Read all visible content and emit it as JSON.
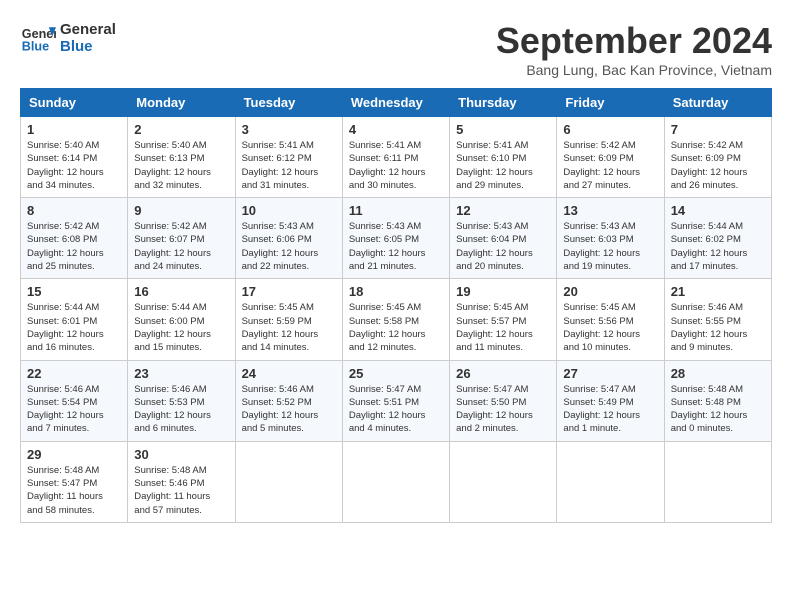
{
  "header": {
    "logo_line1": "General",
    "logo_line2": "Blue",
    "month": "September 2024",
    "location": "Bang Lung, Bac Kan Province, Vietnam"
  },
  "weekdays": [
    "Sunday",
    "Monday",
    "Tuesday",
    "Wednesday",
    "Thursday",
    "Friday",
    "Saturday"
  ],
  "weeks": [
    [
      {
        "day": 1,
        "info": "Sunrise: 5:40 AM\nSunset: 6:14 PM\nDaylight: 12 hours\nand 34 minutes."
      },
      {
        "day": 2,
        "info": "Sunrise: 5:40 AM\nSunset: 6:13 PM\nDaylight: 12 hours\nand 32 minutes."
      },
      {
        "day": 3,
        "info": "Sunrise: 5:41 AM\nSunset: 6:12 PM\nDaylight: 12 hours\nand 31 minutes."
      },
      {
        "day": 4,
        "info": "Sunrise: 5:41 AM\nSunset: 6:11 PM\nDaylight: 12 hours\nand 30 minutes."
      },
      {
        "day": 5,
        "info": "Sunrise: 5:41 AM\nSunset: 6:10 PM\nDaylight: 12 hours\nand 29 minutes."
      },
      {
        "day": 6,
        "info": "Sunrise: 5:42 AM\nSunset: 6:09 PM\nDaylight: 12 hours\nand 27 minutes."
      },
      {
        "day": 7,
        "info": "Sunrise: 5:42 AM\nSunset: 6:09 PM\nDaylight: 12 hours\nand 26 minutes."
      }
    ],
    [
      {
        "day": 8,
        "info": "Sunrise: 5:42 AM\nSunset: 6:08 PM\nDaylight: 12 hours\nand 25 minutes."
      },
      {
        "day": 9,
        "info": "Sunrise: 5:42 AM\nSunset: 6:07 PM\nDaylight: 12 hours\nand 24 minutes."
      },
      {
        "day": 10,
        "info": "Sunrise: 5:43 AM\nSunset: 6:06 PM\nDaylight: 12 hours\nand 22 minutes."
      },
      {
        "day": 11,
        "info": "Sunrise: 5:43 AM\nSunset: 6:05 PM\nDaylight: 12 hours\nand 21 minutes."
      },
      {
        "day": 12,
        "info": "Sunrise: 5:43 AM\nSunset: 6:04 PM\nDaylight: 12 hours\nand 20 minutes."
      },
      {
        "day": 13,
        "info": "Sunrise: 5:43 AM\nSunset: 6:03 PM\nDaylight: 12 hours\nand 19 minutes."
      },
      {
        "day": 14,
        "info": "Sunrise: 5:44 AM\nSunset: 6:02 PM\nDaylight: 12 hours\nand 17 minutes."
      }
    ],
    [
      {
        "day": 15,
        "info": "Sunrise: 5:44 AM\nSunset: 6:01 PM\nDaylight: 12 hours\nand 16 minutes."
      },
      {
        "day": 16,
        "info": "Sunrise: 5:44 AM\nSunset: 6:00 PM\nDaylight: 12 hours\nand 15 minutes."
      },
      {
        "day": 17,
        "info": "Sunrise: 5:45 AM\nSunset: 5:59 PM\nDaylight: 12 hours\nand 14 minutes."
      },
      {
        "day": 18,
        "info": "Sunrise: 5:45 AM\nSunset: 5:58 PM\nDaylight: 12 hours\nand 12 minutes."
      },
      {
        "day": 19,
        "info": "Sunrise: 5:45 AM\nSunset: 5:57 PM\nDaylight: 12 hours\nand 11 minutes."
      },
      {
        "day": 20,
        "info": "Sunrise: 5:45 AM\nSunset: 5:56 PM\nDaylight: 12 hours\nand 10 minutes."
      },
      {
        "day": 21,
        "info": "Sunrise: 5:46 AM\nSunset: 5:55 PM\nDaylight: 12 hours\nand 9 minutes."
      }
    ],
    [
      {
        "day": 22,
        "info": "Sunrise: 5:46 AM\nSunset: 5:54 PM\nDaylight: 12 hours\nand 7 minutes."
      },
      {
        "day": 23,
        "info": "Sunrise: 5:46 AM\nSunset: 5:53 PM\nDaylight: 12 hours\nand 6 minutes."
      },
      {
        "day": 24,
        "info": "Sunrise: 5:46 AM\nSunset: 5:52 PM\nDaylight: 12 hours\nand 5 minutes."
      },
      {
        "day": 25,
        "info": "Sunrise: 5:47 AM\nSunset: 5:51 PM\nDaylight: 12 hours\nand 4 minutes."
      },
      {
        "day": 26,
        "info": "Sunrise: 5:47 AM\nSunset: 5:50 PM\nDaylight: 12 hours\nand 2 minutes."
      },
      {
        "day": 27,
        "info": "Sunrise: 5:47 AM\nSunset: 5:49 PM\nDaylight: 12 hours\nand 1 minute."
      },
      {
        "day": 28,
        "info": "Sunrise: 5:48 AM\nSunset: 5:48 PM\nDaylight: 12 hours\nand 0 minutes."
      }
    ],
    [
      {
        "day": 29,
        "info": "Sunrise: 5:48 AM\nSunset: 5:47 PM\nDaylight: 11 hours\nand 58 minutes."
      },
      {
        "day": 30,
        "info": "Sunrise: 5:48 AM\nSunset: 5:46 PM\nDaylight: 11 hours\nand 57 minutes."
      },
      null,
      null,
      null,
      null,
      null
    ]
  ]
}
